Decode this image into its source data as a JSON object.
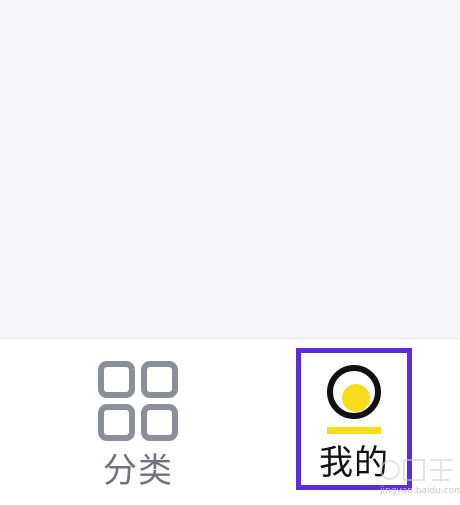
{
  "tab_bar": {
    "tabs": [
      {
        "label": "分类",
        "icon": "grid-icon",
        "color": "#8a8f99",
        "selected": false
      },
      {
        "label": "我的",
        "icon": "profile-circle-icon",
        "color": "#111111",
        "accent": "#f5dd1c",
        "selected": true
      }
    ],
    "highlight_color": "#5c2bdc"
  },
  "watermark": {
    "text": "jingyan.baidu.com"
  }
}
